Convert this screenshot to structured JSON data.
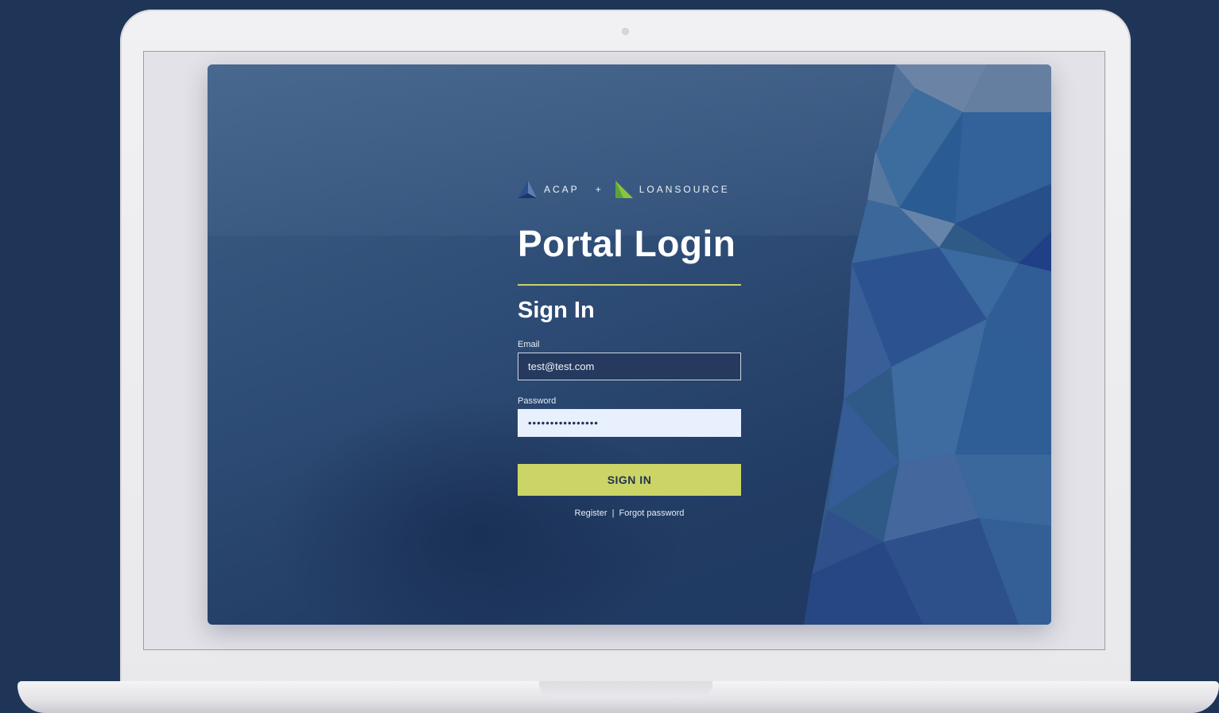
{
  "brand": {
    "acap_name": "ACAP",
    "plus": "+",
    "loansource_name": "LOANSOURCE"
  },
  "page": {
    "title": "Portal Login",
    "subtitle": "Sign In"
  },
  "form": {
    "email_label": "Email",
    "email_value": "test@test.com",
    "password_label": "Password",
    "password_value": "••••••••••••••••",
    "submit_label": "SIGN IN"
  },
  "links": {
    "register": "Register",
    "separator": "|",
    "forgot": "Forgot password"
  },
  "colors": {
    "background": "#1f3558",
    "accent": "#cbd467",
    "button_text": "#23324f"
  },
  "icons": {
    "acap": "acap-logo-icon",
    "loansource": "loansource-logo-icon"
  }
}
